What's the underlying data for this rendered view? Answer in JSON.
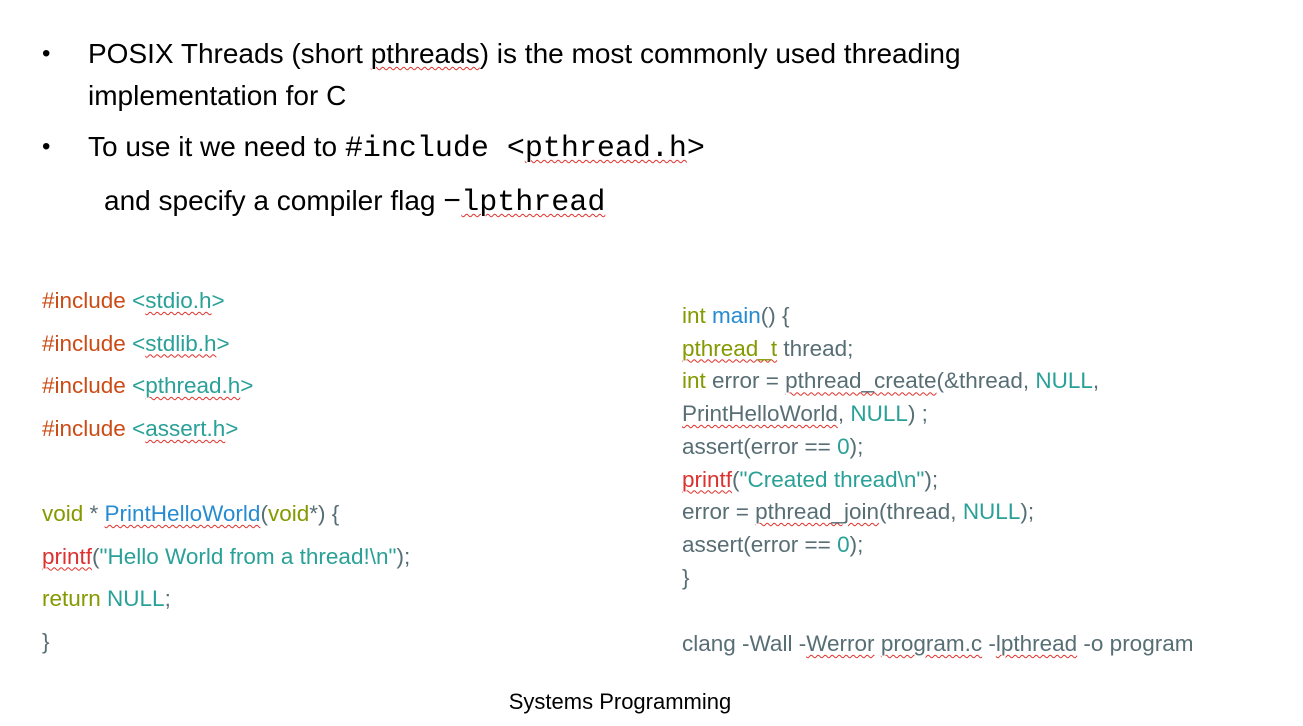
{
  "bullets": [
    {
      "parts": [
        [
          "POSIX Threads (short ",
          ""
        ],
        [
          "pthreads",
          "sq"
        ],
        [
          ") is the most commonly used threading",
          ""
        ]
      ],
      "line2": "implementation for C"
    },
    {
      "parts": [
        [
          "To use it we need to ",
          ""
        ],
        [
          "#include <",
          "mono"
        ],
        [
          "pthread.h",
          "mono sq"
        ],
        [
          ">",
          "mono"
        ]
      ]
    }
  ],
  "sub_line": [
    [
      "and specify a compiler flag ",
      ""
    ],
    [
      "−",
      "mono"
    ],
    [
      "lpthread",
      "mono sq"
    ]
  ],
  "colors": {
    "orange": "#CB4B16",
    "teal": "#2AA198",
    "olive": "#859900",
    "blue": "#268BD2",
    "red": "#DC322F",
    "gray": "#586E75"
  },
  "left_code": [
    [
      [
        "#include ",
        "orange"
      ],
      [
        "<",
        "teal"
      ],
      [
        "stdio.h",
        "teal sq"
      ],
      [
        ">",
        "teal"
      ]
    ],
    [
      [
        "#include ",
        "orange"
      ],
      [
        "<",
        "teal"
      ],
      [
        "stdlib.h",
        "teal sq"
      ],
      [
        ">",
        "teal"
      ]
    ],
    [
      [
        "#include ",
        "orange"
      ],
      [
        "<",
        "teal"
      ],
      [
        "pthread.h",
        "teal sq"
      ],
      [
        ">",
        "teal"
      ]
    ],
    [
      [
        "#include ",
        "orange"
      ],
      [
        "<",
        "teal"
      ],
      [
        "assert.h",
        "teal sq"
      ],
      [
        ">",
        "teal"
      ]
    ],
    [],
    [
      [
        "void",
        "olive"
      ],
      [
        " * ",
        "gray"
      ],
      [
        "PrintHelloWorld",
        "blue sq"
      ],
      [
        "(",
        "gray"
      ],
      [
        "void",
        "olive"
      ],
      [
        "*) {",
        "gray"
      ]
    ],
    [
      [
        "printf",
        "red sq"
      ],
      [
        "(",
        "gray"
      ],
      [
        "\"Hello World from a thread!\\n\"",
        "teal"
      ],
      [
        ");",
        "gray"
      ]
    ],
    [
      [
        "return ",
        "olive"
      ],
      [
        "NULL",
        "teal"
      ],
      [
        ";",
        "gray"
      ]
    ],
    [
      [
        "}",
        "gray"
      ]
    ]
  ],
  "right_code": [
    [
      [
        "int ",
        "olive"
      ],
      [
        "main",
        "blue"
      ],
      [
        "() {",
        "gray"
      ]
    ],
    [
      [
        "pthread_t",
        "olive sq"
      ],
      [
        " thread;",
        "gray"
      ]
    ],
    [
      [
        "int ",
        "olive"
      ],
      [
        "error = ",
        "gray"
      ],
      [
        "pthread_create",
        "gray sq"
      ],
      [
        "(&thread, ",
        "gray"
      ],
      [
        "NULL",
        "teal"
      ],
      [
        ",",
        "gray"
      ]
    ],
    [
      [
        "PrintHelloWorld",
        "gray sq"
      ],
      [
        ", ",
        "gray"
      ],
      [
        "NULL",
        "teal"
      ],
      [
        ") ;",
        "gray"
      ]
    ],
    [
      [
        "assert(error == ",
        "gray"
      ],
      [
        "0",
        "teal"
      ],
      [
        ");",
        "gray"
      ]
    ],
    [
      [
        "printf",
        "red sq"
      ],
      [
        "(",
        "gray"
      ],
      [
        "\"Created thread\\n\"",
        "teal"
      ],
      [
        ");",
        "gray"
      ]
    ],
    [
      [
        "error = ",
        "gray"
      ],
      [
        "pthread_join",
        "gray sq"
      ],
      [
        "(thread, ",
        "gray"
      ],
      [
        "NULL",
        "teal"
      ],
      [
        ");",
        "gray"
      ]
    ],
    [
      [
        "assert(error == ",
        "gray"
      ],
      [
        "0",
        "teal"
      ],
      [
        ");",
        "gray"
      ]
    ],
    [
      [
        "}",
        "gray"
      ]
    ]
  ],
  "compile_command": [
    [
      "clang -Wall -",
      "gray"
    ],
    [
      "Werror",
      "gray sq"
    ],
    [
      " ",
      "gray"
    ],
    [
      "program.c",
      "gray sq"
    ],
    [
      " -",
      "gray"
    ],
    [
      "lpthread",
      "gray sq"
    ],
    [
      " -o program",
      "gray"
    ]
  ],
  "footer": "Systems Programming"
}
